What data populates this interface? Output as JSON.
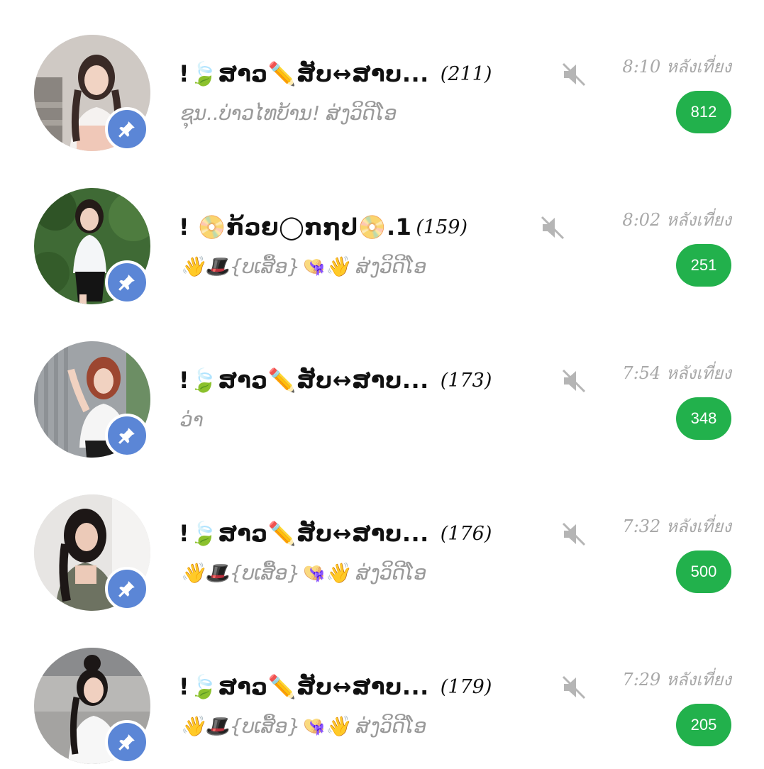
{
  "colors": {
    "unread_badge": "#22b14c",
    "pin_badge": "#5b86d6",
    "timestamp": "#a8a8a8",
    "preview": "#9a9a9a"
  },
  "chats": [
    {
      "title": "!🍃ສາວ✏️ສັບ↔ສາບ...",
      "member_count": "(211)",
      "preview": "ຊຸນ..ບ່າວໄທບ້ານ! ສ່ງວິດີໂອ",
      "timestamp": "8:10 หลังเที่ยง",
      "unread": "812",
      "muted_icon": "mute-icon",
      "pinned_icon": "pin-icon"
    },
    {
      "title": "! 📀ກ້ວຍ◯ກ໗ປ📀.1",
      "member_count": "(159)",
      "preview": "👋🎩{ບເສື້ອ}👒👋 ສ່ງວິດີໂອ",
      "timestamp": "8:02 หลังเที่ยง",
      "unread": "251",
      "muted_icon": "mute-icon",
      "pinned_icon": "pin-icon"
    },
    {
      "title": "!🍃ສາວ✏️ສັບ↔ສາບ...",
      "member_count": "(173)",
      "preview": "ວ່າ",
      "timestamp": "7:54 หลังเที่ยง",
      "unread": "348",
      "muted_icon": "mute-icon",
      "pinned_icon": "pin-icon"
    },
    {
      "title": "!🍃ສາວ✏️ສັບ↔ສາບ...",
      "member_count": "(176)",
      "preview": "👋🎩{ບເສື້ອ}👒👋 ສ່ງວິດີໂອ",
      "timestamp": "7:32 หลังเที่ยง",
      "unread": "500",
      "muted_icon": "mute-icon",
      "pinned_icon": "pin-icon"
    },
    {
      "title": "!🍃ສາວ✏️ສັບ↔ສາບ...",
      "member_count": "(179)",
      "preview": "👋🎩{ບເສື້ອ}👒👋 ສ່ງວິດີໂອ",
      "timestamp": "7:29 หลังเที่ยง",
      "unread": "205",
      "muted_icon": "mute-icon",
      "pinned_icon": "pin-icon"
    }
  ]
}
